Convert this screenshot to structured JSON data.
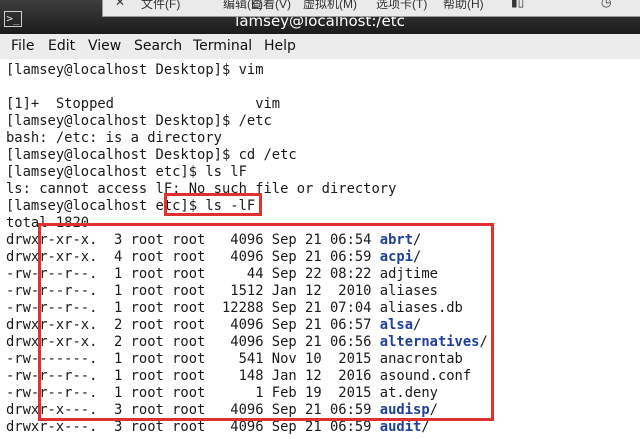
{
  "window": {
    "title": "lamsey@localhost:/etc",
    "icon": "terminal-icon",
    "icon_glyph": ">_"
  },
  "background_window": {
    "items": [
      "文件(F)",
      "编辑(E)",
      "查看(V)",
      "虚拟机(M)",
      "选项卡(T)",
      "帮助(H)"
    ]
  },
  "menu": {
    "items": [
      "File",
      "Edit",
      "View",
      "Search",
      "Terminal",
      "Help"
    ]
  },
  "terminal": {
    "lines": [
      {
        "text": "[lamsey@localhost Desktop]$ vim"
      },
      {
        "text": ""
      },
      {
        "text": "[1]+  Stopped                 vim"
      },
      {
        "text": "[lamsey@localhost Desktop]$ /etc"
      },
      {
        "text": "bash: /etc: is a directory"
      },
      {
        "text": "[lamsey@localhost Desktop]$ cd /etc"
      },
      {
        "text": "[lamsey@localhost etc]$ ls lF"
      },
      {
        "text": "ls: cannot access lF: No such file or directory"
      },
      {
        "text": "[lamsey@localhost etc]$ ls -lF"
      },
      {
        "text": "total 1820"
      },
      {
        "text": "drwxr-xr-x.  3 root root   4096 Sep 21 06:54 ",
        "name": "abrt",
        "suffix": "/",
        "dir": true
      },
      {
        "text": "drwxr-xr-x.  4 root root   4096 Sep 21 06:59 ",
        "name": "acpi",
        "suffix": "/",
        "dir": true
      },
      {
        "text": "-rw-r--r--.  1 root root     44 Sep 22 08:22 ",
        "name": "adjtime",
        "suffix": "",
        "dir": false
      },
      {
        "text": "-rw-r--r--.  1 root root   1512 Jan 12  2010 ",
        "name": "aliases",
        "suffix": "",
        "dir": false
      },
      {
        "text": "-rw-r--r--.  1 root root  12288 Sep 21 07:04 ",
        "name": "aliases.db",
        "suffix": "",
        "dir": false
      },
      {
        "text": "drwxr-xr-x.  2 root root   4096 Sep 21 06:57 ",
        "name": "alsa",
        "suffix": "/",
        "dir": true
      },
      {
        "text": "drwxr-xr-x.  2 root root   4096 Sep 21 06:56 ",
        "name": "alternatives",
        "suffix": "/",
        "dir": true
      },
      {
        "text": "-rw-------.  1 root root    541 Nov 10  2015 ",
        "name": "anacrontab",
        "suffix": "",
        "dir": false
      },
      {
        "text": "-rw-r--r--.  1 root root    148 Jan 12  2016 ",
        "name": "asound.conf",
        "suffix": "",
        "dir": false
      },
      {
        "text": "-rw-r--r--.  1 root root      1 Feb 19  2015 ",
        "name": "at.deny",
        "suffix": "",
        "dir": false
      },
      {
        "text": "drwxr-x---.  3 root root   4096 Sep 21 06:59 ",
        "name": "audisp",
        "suffix": "/",
        "dir": true
      },
      {
        "text": "drwxr-x---.  3 root root   4096 Sep 21 06:59 ",
        "name": "audit",
        "suffix": "/",
        "dir": true
      }
    ]
  },
  "colors": {
    "directory": "#1f3f9e",
    "highlight": "#e03030"
  }
}
